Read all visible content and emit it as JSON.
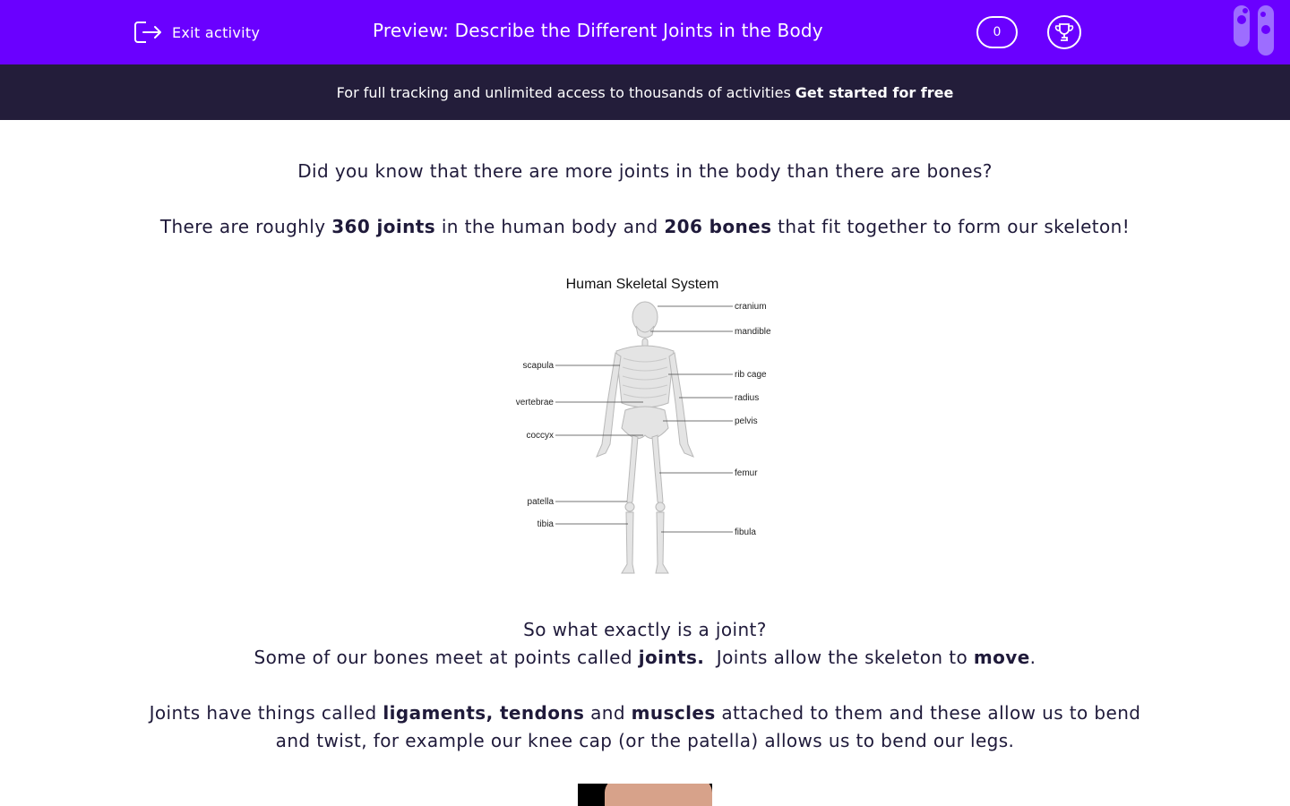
{
  "header": {
    "exit_label": "Exit activity",
    "title": "Preview: Describe the Different Joints in the Body",
    "score": "0",
    "brand_color": "#6a00ff"
  },
  "promo": {
    "text": "For full tracking and unlimited access to thousands of activities",
    "cta": "Get started for free"
  },
  "content": {
    "p1": "Did you know that there are more joints in the body than there are bones?",
    "p2": {
      "a": "There are roughly ",
      "b": "360 joints",
      "c": " in the human body and ",
      "d": "206 bones",
      "e": " that fit together to form our skeleton!"
    },
    "figure": {
      "title": "Human Skeletal System",
      "labels_right": [
        "cranium",
        "mandible",
        "rib cage",
        "radius",
        "pelvis",
        "femur",
        "fibula"
      ],
      "labels_left": [
        "scapula",
        "vertebrae",
        "coccyx",
        "patella",
        "tibia"
      ]
    },
    "p3": "So what exactly is a joint?",
    "p4": {
      "a": "Some of our bones meet at points called ",
      "b": "joints.",
      "c": "  Joints allow the skeleton to ",
      "d": "move",
      "e": "."
    },
    "p5": {
      "a": "Joints have things called ",
      "b": "ligaments, tendons",
      "c": " and ",
      "d": "muscles",
      "e": " attached to them and these allow us to bend"
    },
    "p6": "and twist, for example our knee cap (or the patella) allows us to bend our legs."
  }
}
